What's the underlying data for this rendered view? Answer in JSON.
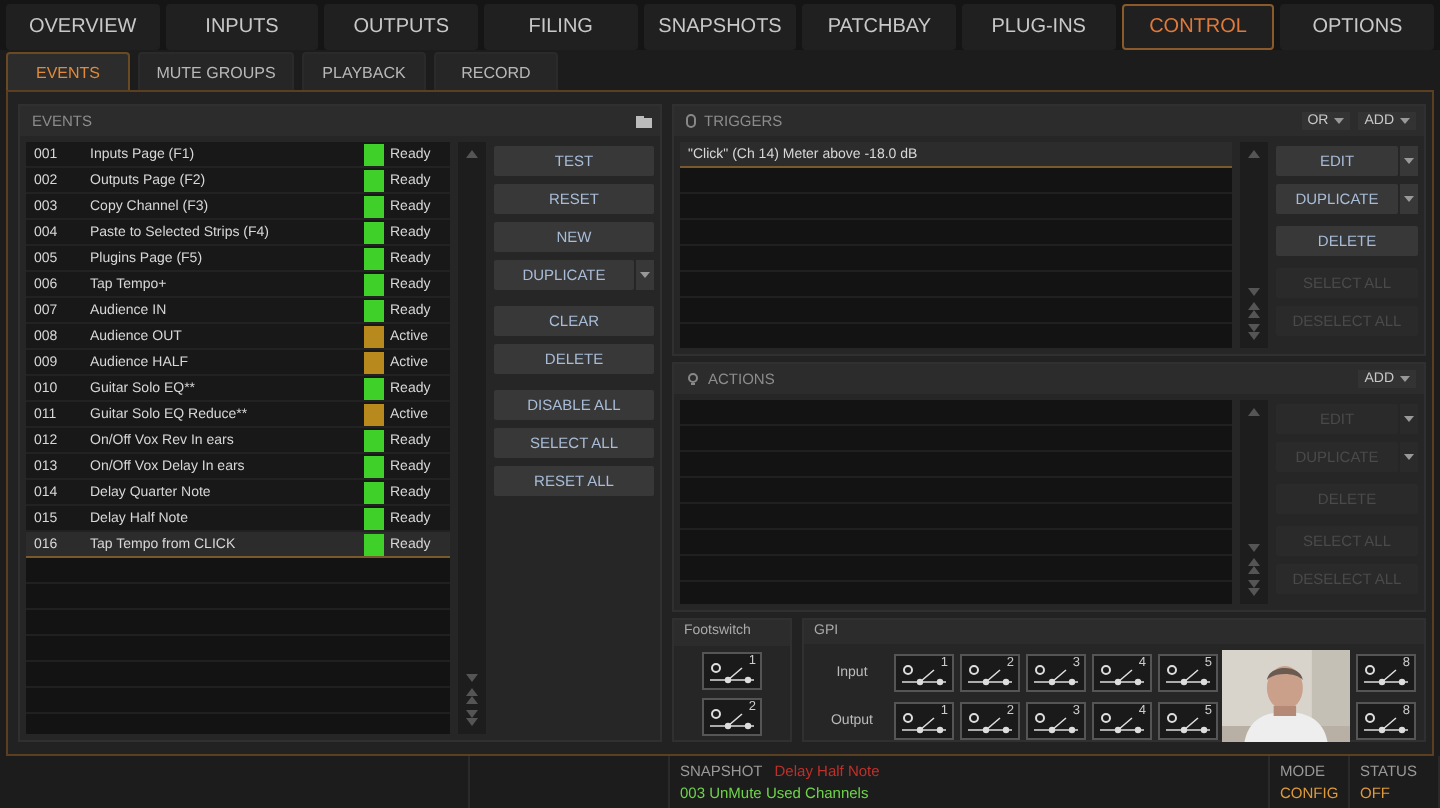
{
  "nav_tabs": [
    {
      "label": "OVERVIEW",
      "selected": false
    },
    {
      "label": "INPUTS",
      "selected": false
    },
    {
      "label": "OUTPUTS",
      "selected": false
    },
    {
      "label": "FILING",
      "selected": false
    },
    {
      "label": "SNAPSHOTS",
      "selected": false
    },
    {
      "label": "PATCHBAY",
      "selected": false
    },
    {
      "label": "PLUG-INS",
      "selected": false
    },
    {
      "label": "CONTROL",
      "selected": true
    },
    {
      "label": "OPTIONS",
      "selected": false
    }
  ],
  "sub_tabs": [
    {
      "label": "EVENTS",
      "selected": true
    },
    {
      "label": "MUTE GROUPS",
      "selected": false
    },
    {
      "label": "PLAYBACK",
      "selected": false
    },
    {
      "label": "RECORD",
      "selected": false
    }
  ],
  "events": {
    "title": "EVENTS",
    "rows": [
      {
        "number": "001",
        "name": "Inputs Page (F1)",
        "status": "Ready",
        "color": "#3fd12a",
        "selected": false
      },
      {
        "number": "002",
        "name": "Outputs Page (F2)",
        "status": "Ready",
        "color": "#3fd12a",
        "selected": false
      },
      {
        "number": "003",
        "name": "Copy Channel (F3)",
        "status": "Ready",
        "color": "#3fd12a",
        "selected": false
      },
      {
        "number": "004",
        "name": "Paste to Selected Strips (F4)",
        "status": "Ready",
        "color": "#3fd12a",
        "selected": false
      },
      {
        "number": "005",
        "name": "Plugins Page (F5)",
        "status": "Ready",
        "color": "#3fd12a",
        "selected": false
      },
      {
        "number": "006",
        "name": "Tap Tempo+",
        "status": "Ready",
        "color": "#3fd12a",
        "selected": false
      },
      {
        "number": "007",
        "name": "Audience IN",
        "status": "Ready",
        "color": "#3fd12a",
        "selected": false
      },
      {
        "number": "008",
        "name": "Audience OUT",
        "status": "Active",
        "color": "#b88a1e",
        "selected": false
      },
      {
        "number": "009",
        "name": "Audience HALF",
        "status": "Active",
        "color": "#b88a1e",
        "selected": false
      },
      {
        "number": "010",
        "name": "Guitar Solo EQ**",
        "status": "Ready",
        "color": "#3fd12a",
        "selected": false
      },
      {
        "number": "011",
        "name": "Guitar Solo EQ Reduce**",
        "status": "Active",
        "color": "#b88a1e",
        "selected": false
      },
      {
        "number": "012",
        "name": "On/Off Vox Rev In ears",
        "status": "Ready",
        "color": "#3fd12a",
        "selected": false
      },
      {
        "number": "013",
        "name": "On/Off Vox Delay In ears",
        "status": "Ready",
        "color": "#3fd12a",
        "selected": false
      },
      {
        "number": "014",
        "name": "Delay Quarter Note",
        "status": "Ready",
        "color": "#3fd12a",
        "selected": false
      },
      {
        "number": "015",
        "name": "Delay Half Note",
        "status": "Ready",
        "color": "#3fd12a",
        "selected": false
      },
      {
        "number": "016",
        "name": "Tap Tempo from CLICK",
        "status": "Ready",
        "color": "#3fd12a",
        "selected": true
      }
    ],
    "button_groups": [
      [
        {
          "label": "TEST",
          "kind": "plain"
        },
        {
          "label": "RESET",
          "kind": "plain"
        },
        {
          "label": "NEW",
          "kind": "plain"
        },
        {
          "label": "DUPLICATE",
          "kind": "dropdown"
        }
      ],
      [
        {
          "label": "CLEAR",
          "kind": "plain"
        },
        {
          "label": "DELETE",
          "kind": "plain"
        }
      ],
      [
        {
          "label": "DISABLE ALL",
          "kind": "plain"
        },
        {
          "label": "SELECT ALL",
          "kind": "plain"
        },
        {
          "label": "RESET ALL",
          "kind": "plain"
        }
      ]
    ]
  },
  "triggers": {
    "title": "TRIGGERS",
    "logic": "OR",
    "add": "ADD",
    "items": [
      {
        "text": "\"Click\" (Ch 14) Meter above -18.0 dB",
        "selected": true
      }
    ],
    "button_groups": [
      [
        {
          "label": "EDIT",
          "kind": "dropdown",
          "disabled": false
        },
        {
          "label": "DUPLICATE",
          "kind": "dropdown",
          "disabled": false
        }
      ],
      [
        {
          "label": "DELETE",
          "kind": "plain",
          "disabled": false
        }
      ],
      [
        {
          "label": "SELECT ALL",
          "kind": "plain",
          "disabled": true
        },
        {
          "label": "DESELECT ALL",
          "kind": "plain",
          "disabled": true
        }
      ]
    ]
  },
  "actions": {
    "title": "ACTIONS",
    "add": "ADD",
    "button_groups": [
      [
        {
          "label": "EDIT",
          "kind": "dropdown",
          "disabled": true
        },
        {
          "label": "DUPLICATE",
          "kind": "dropdown",
          "disabled": true
        }
      ],
      [
        {
          "label": "DELETE",
          "kind": "plain",
          "disabled": true
        }
      ],
      [
        {
          "label": "SELECT ALL",
          "kind": "plain",
          "disabled": true
        },
        {
          "label": "DESELECT ALL",
          "kind": "plain",
          "disabled": true
        }
      ]
    ]
  },
  "footswitch": {
    "title": "Footswitch",
    "switches": [
      {
        "number": "1"
      },
      {
        "number": "2"
      }
    ]
  },
  "gpi": {
    "title": "GPI",
    "rows": [
      {
        "label": "Input",
        "ports": [
          {
            "number": "1"
          },
          {
            "number": "2"
          },
          {
            "number": "3"
          },
          {
            "number": "4"
          },
          {
            "number": "5"
          },
          {
            "number": "8"
          }
        ]
      },
      {
        "label": "Output",
        "ports": [
          {
            "number": "1"
          },
          {
            "number": "2"
          },
          {
            "number": "3"
          },
          {
            "number": "4"
          },
          {
            "number": "5"
          },
          {
            "number": "8"
          }
        ]
      }
    ]
  },
  "status_bar": {
    "snapshot_label": "SNAPSHOT",
    "snapshot_name": "Delay Half Note",
    "snapshot_current": "003 UnMute Used Channels",
    "mode_label": "MODE",
    "mode": "CONFIG",
    "status_label": "STATUS",
    "status": "OFF"
  }
}
